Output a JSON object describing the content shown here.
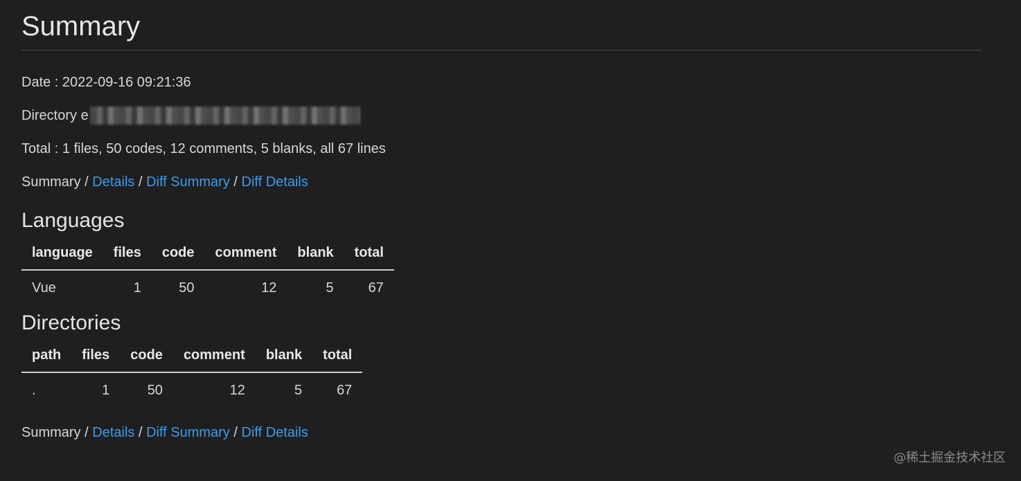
{
  "summary": {
    "title": "Summary",
    "date_label": "Date : 2022-09-16 09:21:36",
    "directory_label": "Directory e",
    "total_label": "Total : 1 files, 50 codes, 12 comments, 5 blanks, all 67 lines"
  },
  "nav": {
    "current": "Summary",
    "separator": " / ",
    "links": [
      "Details",
      "Diff Summary",
      "Diff Details"
    ]
  },
  "languages": {
    "heading": "Languages",
    "columns": [
      "language",
      "files",
      "code",
      "comment",
      "blank",
      "total"
    ],
    "rows": [
      [
        "Vue",
        "1",
        "50",
        "12",
        "5",
        "67"
      ]
    ]
  },
  "directories": {
    "heading": "Directories",
    "columns": [
      "path",
      "files",
      "code",
      "comment",
      "blank",
      "total"
    ],
    "rows": [
      [
        ".",
        "1",
        "50",
        "12",
        "5",
        "67"
      ]
    ]
  },
  "watermark": "@稀土掘金技术社区",
  "colors": {
    "background": "#1f1f1f",
    "link": "#3c9ce8",
    "text": "#d4d4d4"
  }
}
